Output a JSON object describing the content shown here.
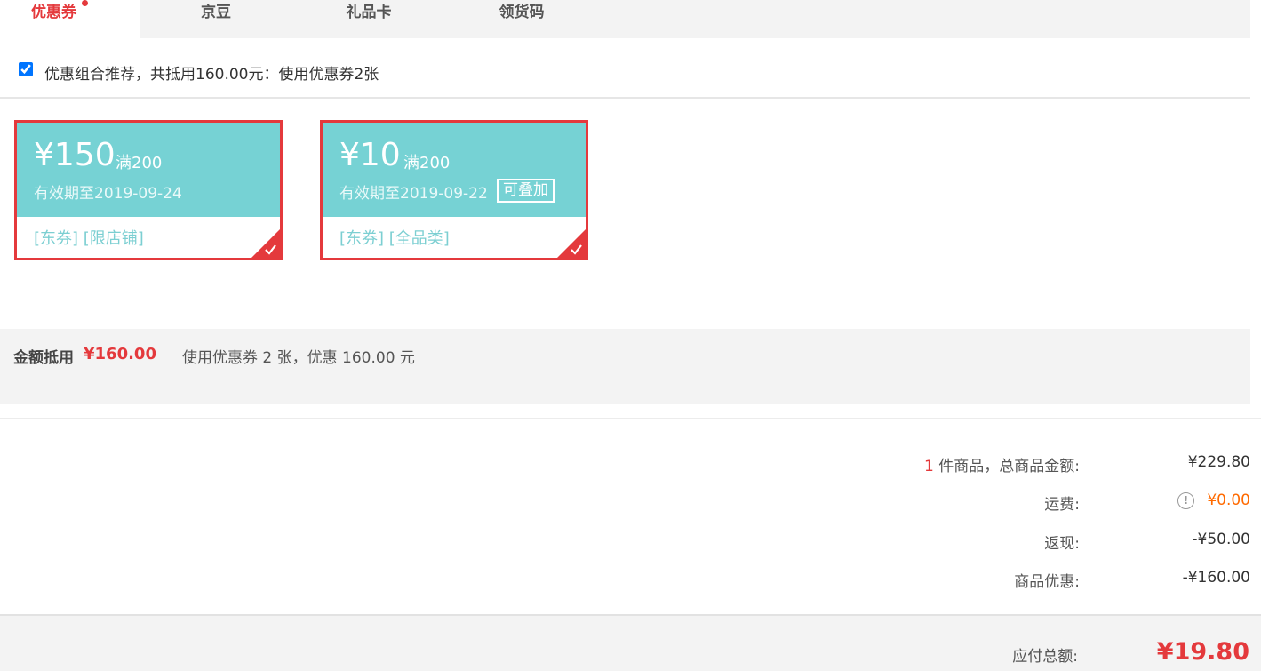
{
  "tabs": [
    {
      "label": "优惠券",
      "active": true
    },
    {
      "label": "京豆",
      "active": false
    },
    {
      "label": "礼品卡",
      "active": false
    },
    {
      "label": "领货码",
      "active": false
    }
  ],
  "combo": {
    "checked": true,
    "text": "优惠组合推荐，共抵用160.00元：使用优惠券2张"
  },
  "coupons": [
    {
      "amount": "¥150",
      "condition": "满200",
      "expiry": "有效期至2019-09-24",
      "stackable_label": "",
      "tags": "[东券]  [限店铺]",
      "selected": true
    },
    {
      "amount": "¥10",
      "condition": "满200",
      "expiry": "有效期至2019-09-22",
      "stackable_label": "可叠加",
      "tags": "[东券]  [全品类]",
      "selected": true
    }
  ],
  "discount": {
    "label": "金额抵用",
    "amount": "¥160.00",
    "description": "使用优惠券 2 张，优惠 160.00 元"
  },
  "summary": {
    "item_count": "1",
    "items_label": " 件商品，总商品金额:",
    "items_value": "¥229.80",
    "freight_label": "运费:",
    "freight_value": "¥0.00",
    "cashback_label": "返现:",
    "cashback_value": "-¥50.00",
    "product_discount_label": "商品优惠:",
    "product_discount_value": "-¥160.00"
  },
  "total": {
    "label": "应付总额:",
    "value": "¥19.80"
  },
  "colors": {
    "accent": "#e4393c",
    "coupon_bg": "#76d2d4",
    "freight": "#ff6a00"
  }
}
